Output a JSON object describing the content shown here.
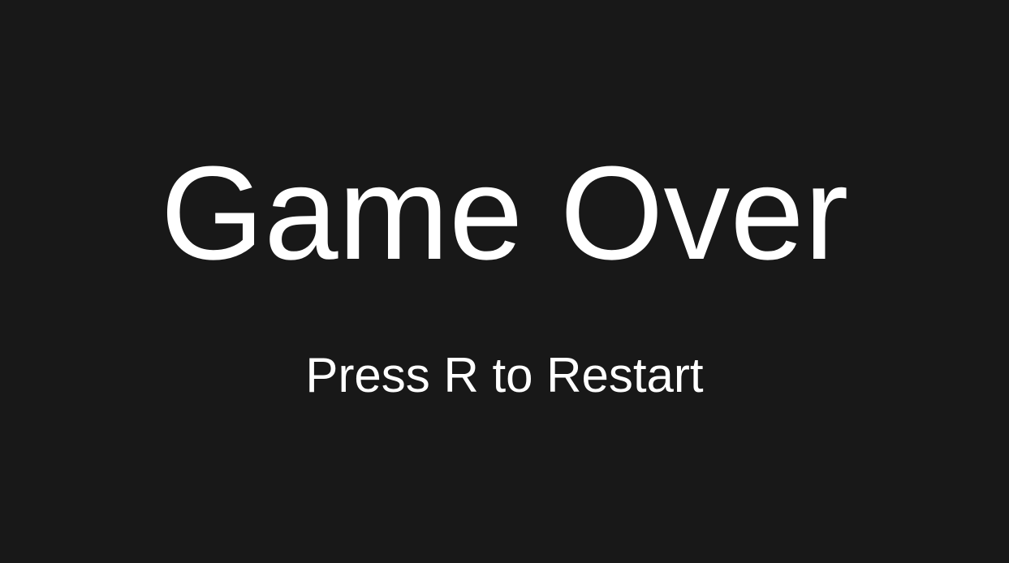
{
  "screen": {
    "title": "Game Over",
    "subtitle": "Press R to Restart",
    "background_color": "#181818",
    "text_color": "#ffffff"
  }
}
